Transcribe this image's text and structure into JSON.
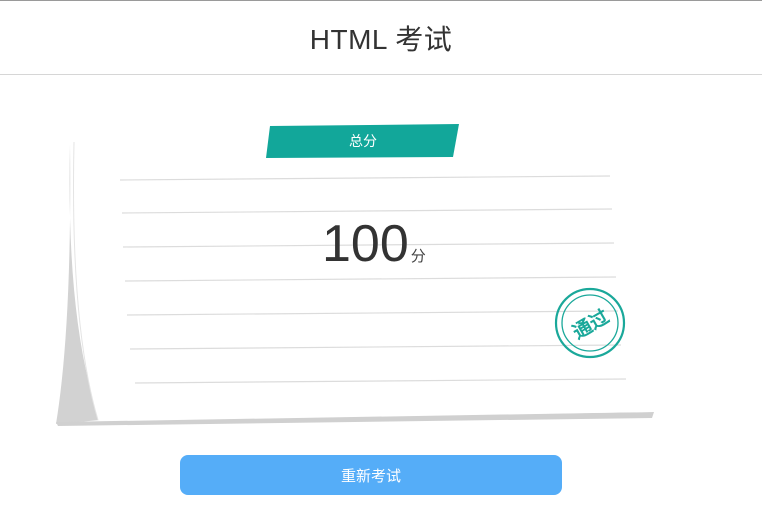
{
  "header": {
    "title": "HTML 考试"
  },
  "result": {
    "label": "总分",
    "score": "100",
    "unit": "分",
    "stamp": "通过"
  },
  "actions": {
    "retry_label": "重新考试"
  },
  "colors": {
    "accent": "#12a79a",
    "button": "#55adf8",
    "stamp": "#1aa89a"
  }
}
